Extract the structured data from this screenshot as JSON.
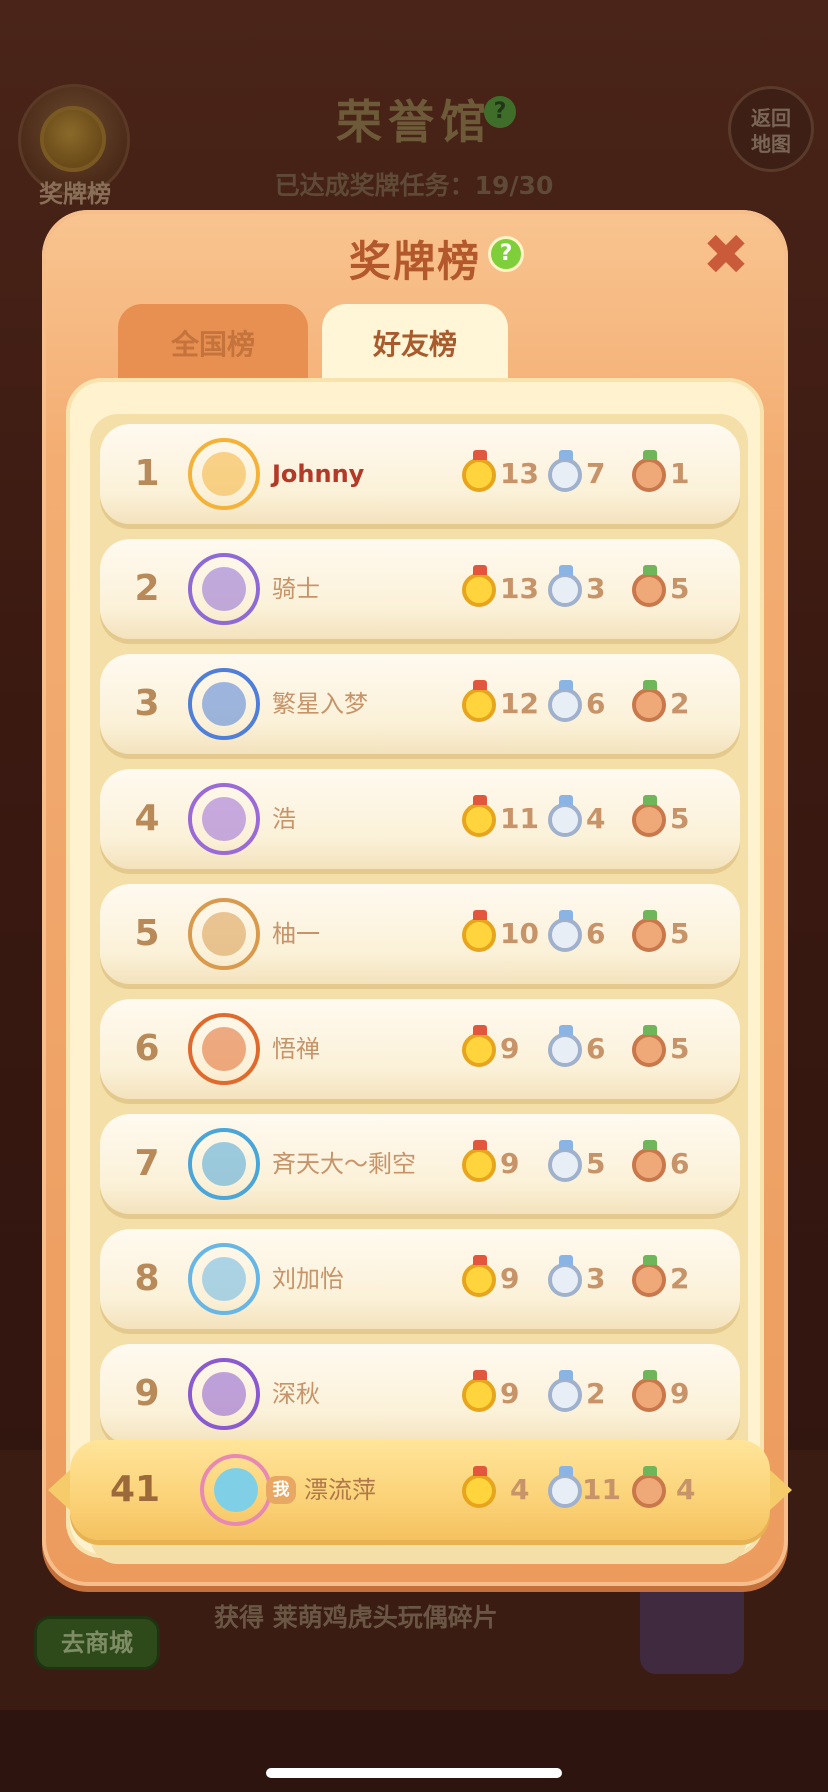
{
  "background": {
    "hall_title": "荣誉馆",
    "progress_label": "已达成奖牌任务：",
    "progress_value": "19/30",
    "badge_button_label": "奖牌榜",
    "return_button_line1": "返回",
    "return_button_line2": "地图",
    "shop_button_label": "去商城",
    "reward_text": "获得 莱萌鸡虎头玩偶碎片"
  },
  "modal": {
    "title": "奖牌榜",
    "help_symbol": "?",
    "close_symbol": "✖",
    "tabs": [
      {
        "label": "全国榜",
        "selected": false
      },
      {
        "label": "好友榜",
        "selected": true
      }
    ]
  },
  "rows": [
    {
      "rank": "1",
      "name": "Johnny",
      "gold": "13",
      "silver": "7",
      "bronze": "1",
      "avatar_color": "#f4b23a"
    },
    {
      "rank": "2",
      "name": "骑士",
      "gold": "13",
      "silver": "3",
      "bronze": "5",
      "avatar_color": "#8e6ad6"
    },
    {
      "rank": "3",
      "name": "繁星入梦",
      "gold": "12",
      "silver": "6",
      "bronze": "2",
      "avatar_color": "#4f7fd8"
    },
    {
      "rank": "4",
      "name": "浩",
      "gold": "11",
      "silver": "4",
      "bronze": "5",
      "avatar_color": "#9b6ad9"
    },
    {
      "rank": "5",
      "name": "柚一",
      "gold": "10",
      "silver": "6",
      "bronze": "5",
      "avatar_color": "#d99a4e"
    },
    {
      "rank": "6",
      "name": "悟禅",
      "gold": "9",
      "silver": "6",
      "bronze": "5",
      "avatar_color": "#e06a2e"
    },
    {
      "rank": "7",
      "name": "斉天大～剩空",
      "gold": "9",
      "silver": "5",
      "bronze": "6",
      "avatar_color": "#4aa6d9"
    },
    {
      "rank": "8",
      "name": "刘加怡",
      "gold": "9",
      "silver": "3",
      "bronze": "2",
      "avatar_color": "#67b6e6"
    },
    {
      "rank": "9",
      "name": "深秋",
      "gold": "9",
      "silver": "2",
      "bronze": "9",
      "avatar_color": "#8a5ad0"
    }
  ],
  "self_row": {
    "rank": "41",
    "me_label": "我",
    "name": "漂流萍",
    "gold": "4",
    "silver": "11",
    "bronze": "4",
    "avatar_color": "#7fd0e6"
  },
  "colors": {
    "gold_medal": "#ffd43c",
    "silver_medal": "#e8eef6",
    "bronze_medal": "#efa878",
    "modal_orange": "#ec9b5d"
  }
}
